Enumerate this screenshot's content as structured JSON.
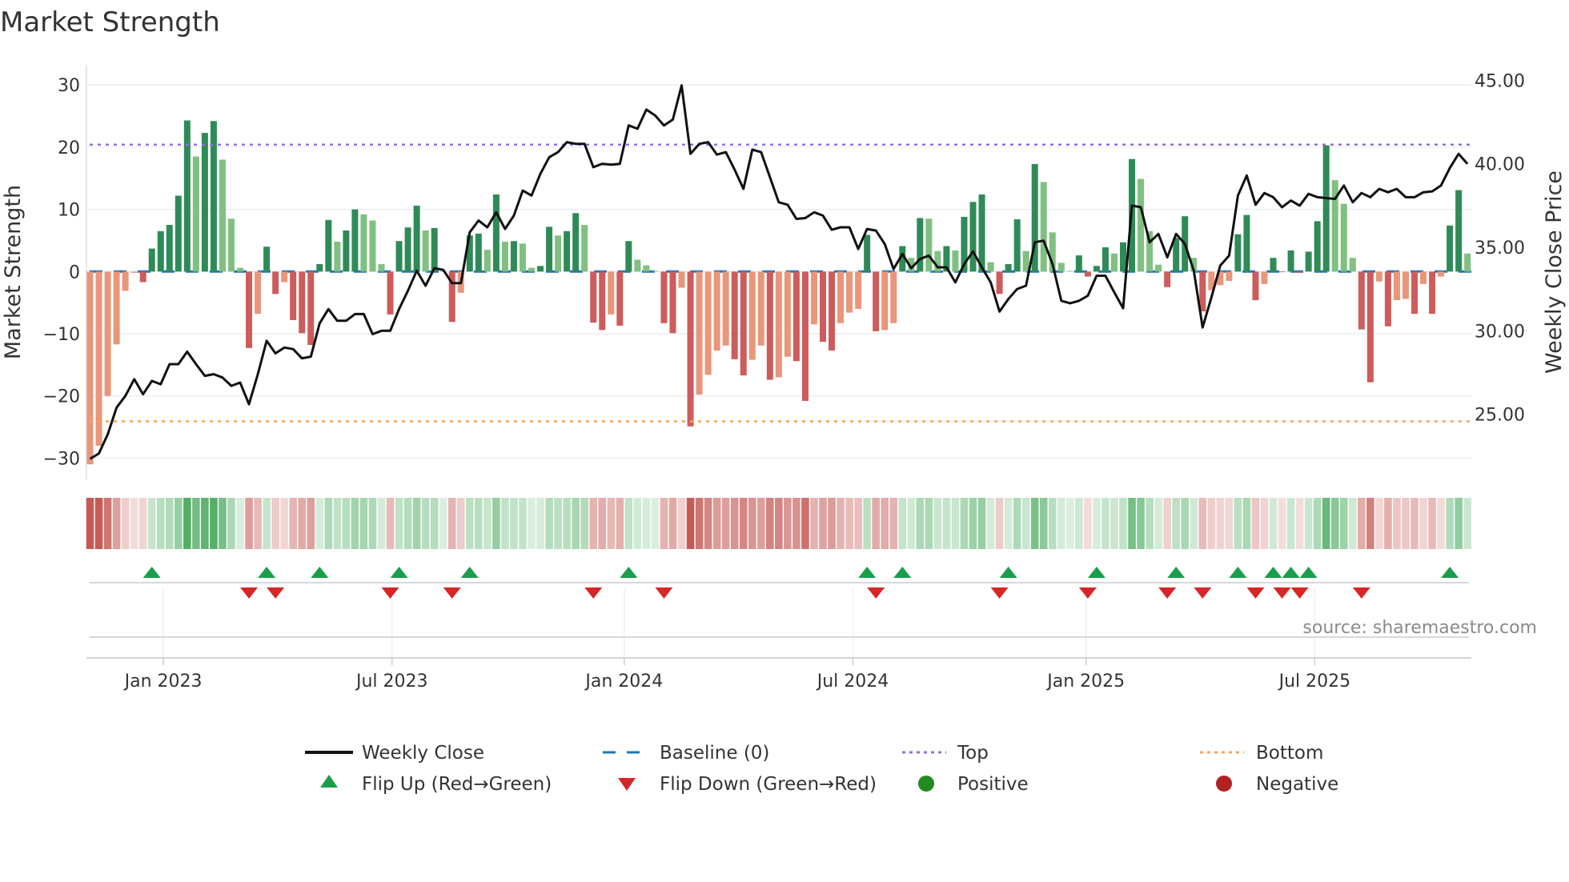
{
  "title": "Market Strength",
  "source": "source: sharemaestro.com",
  "colors": {
    "strong_up": "#2e8b57",
    "weak_up": "#80c080",
    "strong_down": "#cd5c5c",
    "weak_down": "#e9967a",
    "line": "#111111",
    "baseline": "#1f77b4",
    "top": "#9370db",
    "bottom": "#f4a460",
    "flip_up": "#1a9e4a",
    "flip_down": "#d62728",
    "positive": "#228b22",
    "negative": "#b22222"
  },
  "legend": {
    "weekly_close": "Weekly Close",
    "baseline": "Baseline (0)",
    "top": "Top",
    "bottom": "Bottom",
    "flip_up": "Flip Up (Red→Green)",
    "flip_down": "Flip Down (Green→Red)",
    "positive": "Positive",
    "negative": "Negative"
  },
  "chart_data": {
    "type": "bar",
    "title": "Market Strength",
    "ylabel": "Market Strength",
    "y2label": "Weekly Close Price",
    "ylim": [
      -32,
      32
    ],
    "y2lim": [
      22.0,
      45.3
    ],
    "yticks": [
      "30",
      "20",
      "10",
      "0",
      "−10",
      "−20",
      "−30"
    ],
    "ytick_values": [
      30,
      20,
      10,
      0,
      -10,
      -20,
      -30
    ],
    "y2ticks": [
      "45.00",
      "40.00",
      "35.00",
      "30.00",
      "25.00"
    ],
    "y2tick_values": [
      45,
      40,
      35,
      30,
      25
    ],
    "x_unit": "week index (weekly bars, Dec 2022 – Sep 2025)",
    "xticks": [
      {
        "label": "Jan 2023",
        "week_index": 8.3
      },
      {
        "label": "Jul 2023",
        "week_index": 34.2
      },
      {
        "label": "Jan 2024",
        "week_index": 60.5
      },
      {
        "label": "Jul 2024",
        "week_index": 86.4
      },
      {
        "label": "Jan 2025",
        "week_index": 112.8
      },
      {
        "label": "Jul 2025",
        "week_index": 138.7
      }
    ],
    "top_level": 20.4,
    "bottom_level": -24.1,
    "baseline": 0,
    "grid": true,
    "legend_position": "bottom",
    "series": [
      {
        "name": "Market Strength",
        "type": "bar",
        "values": [
          -31,
          -28,
          -20,
          -11.7,
          -3.1,
          -0.2,
          -1.7,
          3.7,
          6.5,
          7.5,
          12.2,
          24.3,
          18.5,
          22.3,
          24.2,
          18,
          8.5,
          0.6,
          -12.3,
          -6.8,
          4,
          -3.6,
          -1.7,
          -7.8,
          -9.9,
          -11.8,
          1.2,
          8.3,
          4.8,
          6.6,
          10,
          9.2,
          8.2,
          1.2,
          -6.9,
          4.9,
          7.1,
          10.6,
          6.6,
          7,
          0.1,
          -8.1,
          -3.4,
          5.8,
          6.1,
          3.5,
          12.4,
          4.8,
          4.9,
          4.5,
          0.6,
          0.9,
          7.2,
          5.8,
          6.5,
          9.4,
          7.5,
          -8.2,
          -9.4,
          -6.9,
          -8.7,
          4.9,
          1.9,
          1.0,
          0.1,
          -8.3,
          -9.9,
          -2.6,
          -24.9,
          -19.8,
          -16.6,
          -12.7,
          -11.9,
          -14.1,
          -16.7,
          -14.2,
          -11.9,
          -17.4,
          -17,
          -13.7,
          -14.4,
          -20.8,
          -8.5,
          -11.3,
          -12.7,
          -8.3,
          -6.6,
          -6.0,
          5.9,
          -9.6,
          -9.4,
          -8.3,
          4.1,
          2.2,
          8.6,
          8.5,
          3.3,
          4.1,
          3.4,
          8.8,
          11.2,
          12.4,
          1.5,
          -3.6,
          1.2,
          8.4,
          3.3,
          17.3,
          14.4,
          6.3,
          1.4,
          0.1,
          2.6,
          -0.8,
          0.9,
          3.9,
          2.9,
          4.7,
          18.1,
          14.9,
          6.5,
          1.1,
          -2.5,
          5.4,
          8.9,
          2.2,
          -6.4,
          -3.0,
          -2.2,
          -1.5,
          6.0,
          9.1,
          -4.6,
          -2.0,
          2.2,
          -0.1,
          3.4,
          -0.2,
          3.2,
          8.1,
          20.3,
          14.7,
          10.9,
          2.2,
          -9.3,
          -17.8,
          -1.6,
          -8.8,
          -4.6,
          -4.4,
          -6.8,
          -2.0,
          -6.8,
          -0.8,
          7.4,
          13.1,
          2.9
        ]
      },
      {
        "name": "Weekly Close",
        "type": "line",
        "axis": "right",
        "values": [
          22.33,
          22.65,
          23.8,
          25.4,
          26.1,
          27.1,
          26.2,
          27.0,
          26.8,
          28.0,
          28.0,
          28.75,
          28.0,
          27.3,
          27.4,
          27.2,
          26.7,
          26.9,
          25.6,
          27.4,
          29.4,
          28.65,
          29.0,
          28.9,
          28.35,
          28.45,
          30.45,
          31.3,
          30.6,
          30.6,
          31.0,
          31.0,
          29.8,
          30.0,
          30.0,
          31.3,
          32.4,
          33.6,
          32.7,
          33.75,
          33.65,
          32.85,
          32.85,
          35.9,
          36.6,
          36.2,
          37.1,
          36.1,
          36.9,
          38.4,
          38.1,
          39.4,
          40.4,
          40.7,
          41.3,
          41.2,
          41.2,
          39.8,
          40.0,
          39.95,
          40.0,
          42.3,
          42.1,
          43.25,
          42.9,
          42.3,
          42.65,
          44.7,
          40.6,
          41.2,
          41.3,
          40.55,
          40.7,
          39.65,
          38.5,
          40.85,
          40.7,
          39.2,
          37.7,
          37.55,
          36.7,
          36.75,
          37.1,
          36.9,
          36.05,
          36.2,
          36.2,
          34.9,
          36.1,
          36.0,
          35.2,
          33.7,
          34.6,
          33.75,
          34.3,
          34.5,
          33.8,
          33.8,
          32.9,
          34.0,
          34.75,
          33.8,
          32.9,
          31.15,
          31.9,
          32.5,
          32.7,
          35.3,
          35.4,
          34.0,
          31.8,
          31.65,
          31.8,
          32.1,
          33.3,
          33.3,
          32.3,
          31.35,
          37.5,
          37.4,
          35.3,
          35.8,
          34.4,
          35.8,
          35.2,
          33.6,
          30.2,
          32.0,
          33.9,
          34.5,
          38.1,
          39.3,
          37.55,
          38.25,
          38.0,
          37.4,
          37.8,
          37.5,
          38.2,
          38.0,
          37.95,
          37.9,
          38.7,
          37.7,
          38.25,
          38.0,
          38.5,
          38.3,
          38.5,
          38.0,
          38.0,
          38.3,
          38.35,
          38.7,
          39.75,
          40.6,
          40.0
        ]
      }
    ]
  }
}
